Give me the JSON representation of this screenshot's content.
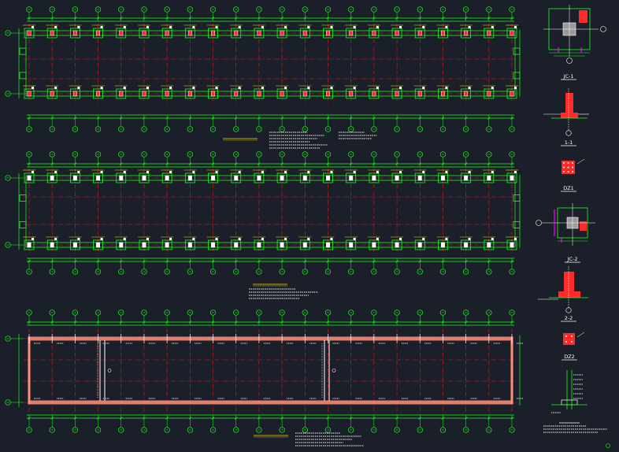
{
  "colors": {
    "background": "#1b1f29",
    "structure": "#19ff19",
    "axis": "#e02020",
    "text_main": "#ffffff",
    "text_yellow": "#f0e000",
    "rebar": "#ff2a2a",
    "magenta": "#ff00ff",
    "beam_fill": "#ff8f7a"
  },
  "plans": {
    "plan1": {
      "title": "",
      "grid_columns": 22,
      "grid_rows": 2,
      "row_labels": [
        "B",
        "A"
      ]
    },
    "plan2": {
      "title": "",
      "grid_columns": 22,
      "grid_rows": 2,
      "row_labels": [
        "B",
        "A"
      ]
    },
    "plan3": {
      "title": "",
      "grid_columns": 22,
      "grid_rows": 2,
      "row_labels": [
        "B",
        "A"
      ]
    }
  },
  "details": {
    "jc1": {
      "label": "JC-1"
    },
    "section1": {
      "label": "1-1"
    },
    "dz1": {
      "label": "DZ1"
    },
    "jc2": {
      "label": "JC-2"
    },
    "section2": {
      "label": "2-2"
    },
    "dz2": {
      "label": "DZ2"
    },
    "wall": {
      "label": ""
    }
  },
  "icons": {
    "column_pedestal": "column-pedestal-icon",
    "axis_bubble": "axis-bubble-icon"
  }
}
